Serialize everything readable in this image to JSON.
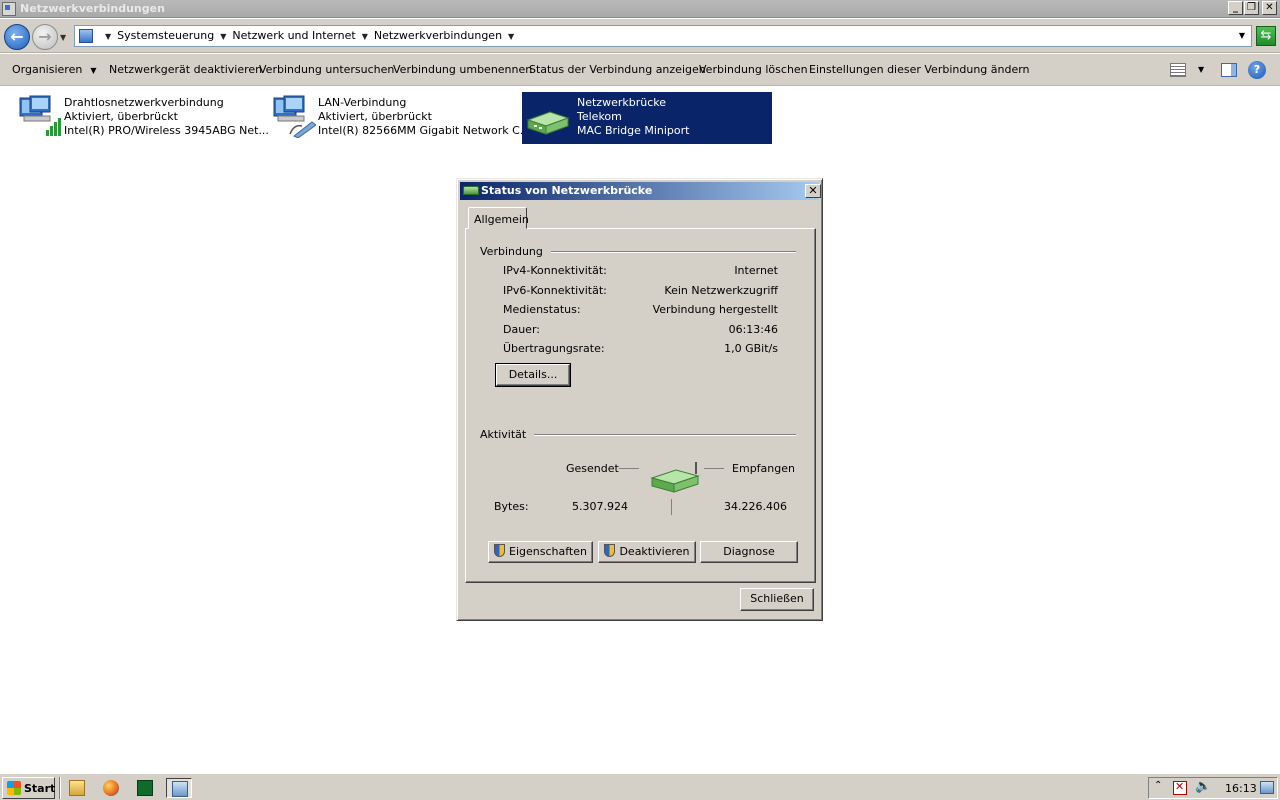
{
  "window": {
    "title": "Netzwerkverbindungen"
  },
  "address": {
    "breadcrumbs": [
      "Systemsteuerung",
      "Netzwerk und Internet",
      "Netzwerkverbindungen"
    ]
  },
  "commands": {
    "organize": "Organisieren",
    "disable": "Netzwerkgerät deaktivieren",
    "diagnose": "Verbindung untersuchen",
    "rename": "Verbindung umbenennen",
    "status": "Status der Verbindung anzeigen",
    "delete": "Verbindung löschen",
    "settings": "Einstellungen dieser Verbindung ändern"
  },
  "connections": [
    {
      "name": "Drahtlosnetzwerkverbindung",
      "status": "Aktiviert, überbrückt",
      "device": "Intel(R) PRO/Wireless 3945ABG Net..."
    },
    {
      "name": "LAN-Verbindung",
      "status": "Aktiviert, überbrückt",
      "device": "Intel(R) 82566MM Gigabit Network C..."
    },
    {
      "name": "Netzwerkbrücke",
      "status": "Telekom",
      "device": "MAC Bridge Miniport"
    }
  ],
  "dialog": {
    "title": "Status von Netzwerkbrücke",
    "tab": "Allgemein",
    "connection_group": "Verbindung",
    "rows": [
      {
        "label": "IPv4-Konnektivität:",
        "value": "Internet"
      },
      {
        "label": "IPv6-Konnektivität:",
        "value": "Kein Netzwerkzugriff"
      },
      {
        "label": "Medienstatus:",
        "value": "Verbindung hergestellt"
      },
      {
        "label": "Dauer:",
        "value": "06:13:46"
      },
      {
        "label": "Übertragungsrate:",
        "value": "1,0 GBit/s"
      }
    ],
    "details_button": "Details...",
    "activity_group": "Aktivität",
    "sent_label": "Gesendet",
    "received_label": "Empfangen",
    "bytes_label": "Bytes:",
    "bytes_sent": "5.307.924",
    "bytes_received": "34.226.406",
    "properties_button": "Eigenschaften",
    "deactivate_button": "Deaktivieren",
    "diagnose_button": "Diagnose",
    "close_button": "Schließen"
  },
  "taskbar": {
    "start": "Start",
    "clock": "16:13"
  }
}
